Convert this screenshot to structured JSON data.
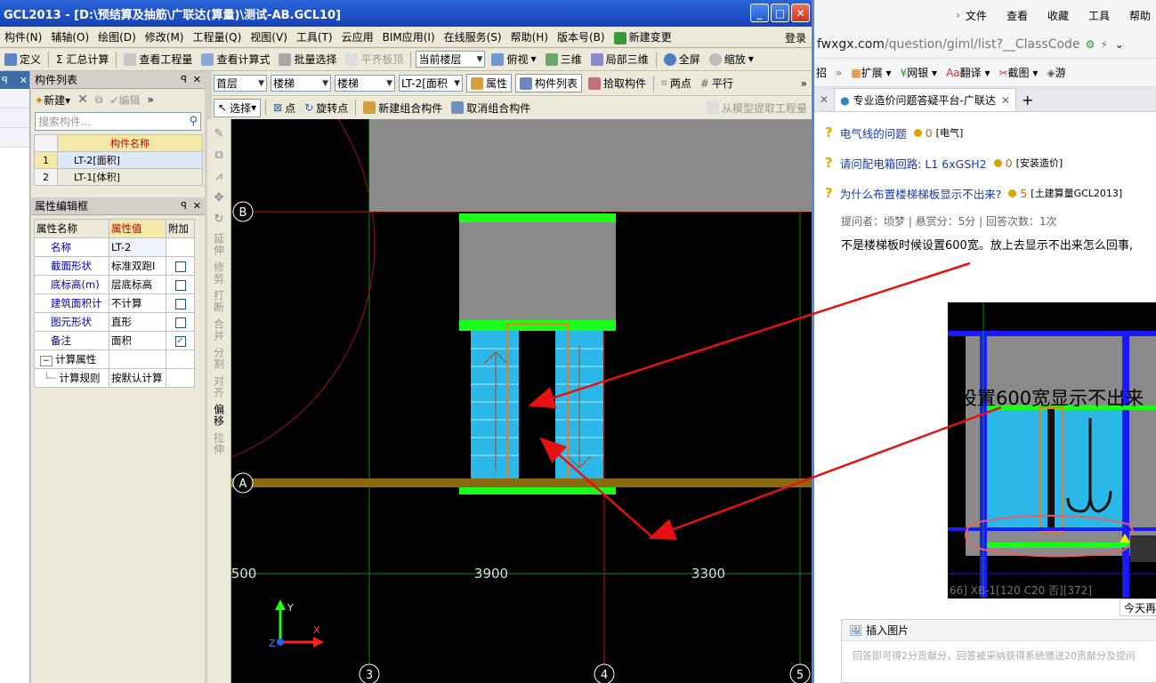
{
  "app": {
    "title": "GCL2013 - [D:\\预结算及抽筋\\广联达(算量)\\测试-AB.GCL10]",
    "menus": [
      "构件(N)",
      "辅轴(O)",
      "绘图(D)",
      "修改(M)",
      "工程量(Q)",
      "视图(V)",
      "工具(T)",
      "云应用",
      "BIM应用(I)",
      "在线服务(S)",
      "帮助(H)",
      "版本号(B)",
      "新建变更"
    ],
    "login": "登录",
    "toolbar1": [
      "定义",
      "Σ 汇总计算",
      "查看工程量",
      "查看计算式",
      "批量选择",
      "平齐板顶",
      "俯视",
      "三维",
      "局部三维",
      "全屏",
      "缩放"
    ],
    "floor_select": "当前楼层",
    "toolbar2": {
      "floor": "首层",
      "cat": "楼梯",
      "type": "楼梯",
      "comp": "LT-2[面积",
      "btns": [
        "属性",
        "构件列表",
        "拾取构件",
        "两点",
        "平行"
      ]
    },
    "toolbar3": [
      "选择",
      "点",
      "旋转点",
      "新建组合构件",
      "取消组合构件",
      "从模型提取工程量"
    ],
    "vtools": [
      "延伸",
      "修剪",
      "打断",
      "合并",
      "分割",
      "对齐",
      "偏移",
      "拉伸"
    ]
  },
  "component_list": {
    "title": "构件列表",
    "new_label": "新建",
    "edit_label": "编辑",
    "search_placeholder": "搜索构件...",
    "header": "构件名称",
    "rows": [
      {
        "num": "1",
        "name": "LT-2[面积]"
      },
      {
        "num": "2",
        "name": "LT-1[体积]"
      }
    ]
  },
  "property_editor": {
    "title": "属性编辑框",
    "headers": [
      "属性名称",
      "属性值",
      "附加"
    ],
    "rows": [
      {
        "name": "名称",
        "value": "LT-2",
        "check": ""
      },
      {
        "name": "截面形状",
        "value": "标准双跑I",
        "check": "off"
      },
      {
        "name": "底标高(m)",
        "value": "层底标高",
        "check": "off"
      },
      {
        "name": "建筑面积计",
        "value": "不计算",
        "check": "off"
      },
      {
        "name": "图元形状",
        "value": "直形",
        "check": "off"
      },
      {
        "name": "备注",
        "value": "面积",
        "check": "on"
      }
    ],
    "group": "计算属性",
    "sub_name": "计算规则",
    "sub_value": "按默认计算"
  },
  "canvas": {
    "axis_labels": [
      "B",
      "A",
      "3",
      "4",
      "5"
    ],
    "dims": [
      "500",
      "3900",
      "3300"
    ],
    "ucs": [
      "Y",
      "X",
      "Z"
    ]
  },
  "browser": {
    "menu": [
      "文件",
      "查看",
      "收藏",
      "工具",
      "帮助"
    ],
    "url_host": "fwxgx.com",
    "url_path": "/question/giml/list?__ClassCode",
    "bar2": [
      "招",
      "扩展",
      "网银",
      "翻译",
      "截图",
      "游"
    ],
    "tab_title": "专业造价问题答疑平台-广联达",
    "questions": [
      {
        "title": "电气线的问题",
        "score": "0",
        "tag": "[电气]"
      },
      {
        "title": "请问配电箱回路: L1 6xGSH2",
        "score": "0",
        "tag": "[安装造价]"
      },
      {
        "title": "为什么布置楼梯梯板显示不出来?",
        "score": "5",
        "tag": "[土建算量GCL2013]"
      }
    ],
    "meta": "提问者：顷梦  |  悬赏分：5分  |  回答次数：1次",
    "question_text": "不是楼梯板时候设置600宽。放上去显示不出来怎么回事,",
    "pic_caption": "设置600宽显示不出来",
    "pic_footer": "66]   XB-1[120 C20 否][372]",
    "today": "今天再",
    "insert_image": "插入图片",
    "answer_placeholder": "回答即可得2分贡献分，回答被采纳获得系统赠送20贡献分及提问"
  }
}
